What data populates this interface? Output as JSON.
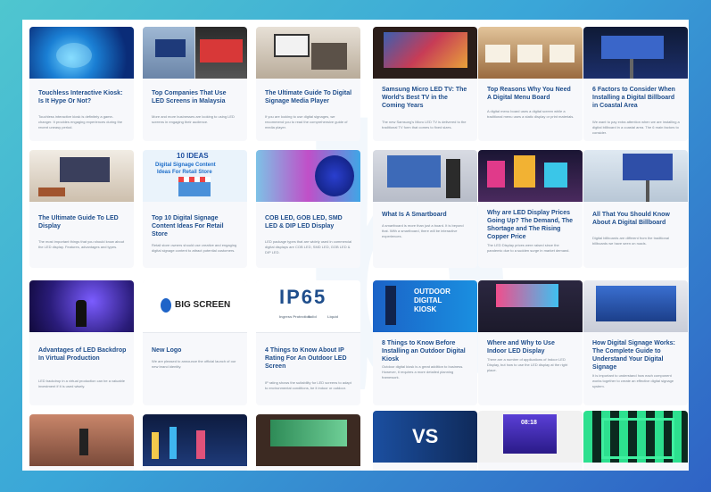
{
  "cards": [
    {
      "title": "Touchless Interactive Kiosk: Is It Hype Or Not?",
      "excerpt": "Touchless interactive kiosk is definitely a game-changer. It provides engaging experiences during the recent uneasy period.",
      "icon": "kiosk-thumbnail"
    },
    {
      "title": "Top Companies That Use LED Screens in Malaysia",
      "excerpt": "More and more businesses are looking to using LED screens in engaging their audience.",
      "icon": "led-screens-thumbnail"
    },
    {
      "title": "The Ultimate Guide To Digital Signage Media Player",
      "excerpt": "If you are looking to use digital signages, we recommend you to read the comprehensive guide of media player.",
      "icon": "media-player-thumbnail"
    },
    {
      "title": "Samsung Micro LED TV: The World's Best TV in the Coming Years",
      "excerpt": "The new Samsung's Micro LED TV is delivered to the traditional TV form that comes to fixed sizes.",
      "icon": "micro-led-tv-thumbnail"
    },
    {
      "title": "Top Reasons Why You Need A Digital Menu Board",
      "excerpt": "A digital menu board uses a digital screen while a traditional menu uses a static display or print materials.",
      "icon": "menu-board-thumbnail"
    },
    {
      "title": "6 Factors to Consider When Installing a Digital Billboard in Coastal Area",
      "excerpt": "We want to pay extra attention when we are installing a digital billboard in a coastal area. The 6 main factors to consider.",
      "icon": "coastal-billboard-thumbnail"
    },
    {
      "title": "The Ultimate Guide To LED Display",
      "excerpt": "The most important things that you should know about the LED display. Features, advantages and types.",
      "icon": "led-display-room-thumbnail"
    },
    {
      "title": "Top 10 Digital Signage Content Ideas For Retail Store",
      "excerpt": "Retail store owners should use creative and engaging digital signage content to attract potential customers.",
      "icon": "content-ideas-thumbnail",
      "thumb_text": {
        "line1": "10 IDEAS",
        "line2": "Digital Signage Content",
        "line3": "Ideas For Retail Store"
      }
    },
    {
      "title": "COB LED, GOB LED, SMD LED & DIP LED Display",
      "excerpt": "LED package types that are widely used in commercial digital displays are COB LED, SMD LED, GOB LED & DIP LED.",
      "icon": "led-types-thumbnail"
    },
    {
      "title": "What Is A Smartboard",
      "excerpt": "A smartboard is more than just a board. It is beyond that. With a smartboard, there will be interactive experiences.",
      "icon": "smartboard-thumbnail"
    },
    {
      "title": "Why are LED Display Prices Going Up? The Demand, The Shortage and The Rising Copper Price",
      "excerpt": "The LED Display prices were raised since the pandemic due to a sudden surge in market demand.",
      "icon": "city-lights-thumbnail"
    },
    {
      "title": "All That You Should Know About A Digital Billboard",
      "excerpt": "Digital billboards are different from the traditional billboards we have seen on roads.",
      "icon": "billboard-thumbnail"
    },
    {
      "title": "Advantages of LED Backdrop In Virtual Production",
      "excerpt": "LED backdrop in a virtual production can be a valuable investment if it is used wisely.",
      "icon": "virtual-production-thumbnail"
    },
    {
      "title": "New Logo",
      "excerpt": "We are pleased to announce the official launch of our new brand identity.",
      "icon": "big-screen-logo-thumbnail",
      "thumb_text": {
        "brand": "BIG SCREEN"
      }
    },
    {
      "title": "4 Things to Know About IP Rating For An Outdoor LED Screen",
      "excerpt": "IP rating shows the suitability for LED screens to adapt to environmental conditions, be it indoor or outdoor.",
      "icon": "ip65-thumbnail",
      "thumb_text": {
        "code": "IP65",
        "sub1": "Ingress Protection",
        "sub2": "Solid",
        "sub3": "Liquid"
      }
    },
    {
      "title": "8 Things to Know Before Installing an Outdoor Digital Kiosk",
      "excerpt": "Outdoor digital kiosk is a great addition to business. However, it requires a more detailed planning framework.",
      "icon": "outdoor-kiosk-thumbnail",
      "thumb_text": {
        "line1": "OUTDOOR",
        "line2": "DIGITAL",
        "line3": "KIOSK"
      }
    },
    {
      "title": "Where and Why to Use Indoor LED Display",
      "excerpt": "There are a number of applications of Indoor LED Display, but how to use the LED display at the right place.",
      "icon": "indoor-led-thumbnail"
    },
    {
      "title": "How Digital Signage Works: The Complete Guide to Understand Your Digital Signage",
      "excerpt": "It is important to understand how each component works together to create an effective digital signage system.",
      "icon": "signage-works-thumbnail"
    },
    {
      "title": "",
      "excerpt": "",
      "icon": "presentation-thumbnail"
    },
    {
      "title": "",
      "excerpt": "",
      "icon": "city-night-thumbnail"
    },
    {
      "title": "",
      "excerpt": "",
      "icon": "led-wall-room-thumbnail"
    },
    {
      "title": "",
      "excerpt": "",
      "icon": "vs-thumbnail",
      "thumb_text": {
        "vs": "VS"
      }
    },
    {
      "title": "",
      "excerpt": "",
      "icon": "display-screen-thumbnail",
      "thumb_text": {
        "clock": "08:18"
      }
    },
    {
      "title": "",
      "excerpt": "",
      "icon": "infinity-tiles-thumbnail"
    }
  ]
}
